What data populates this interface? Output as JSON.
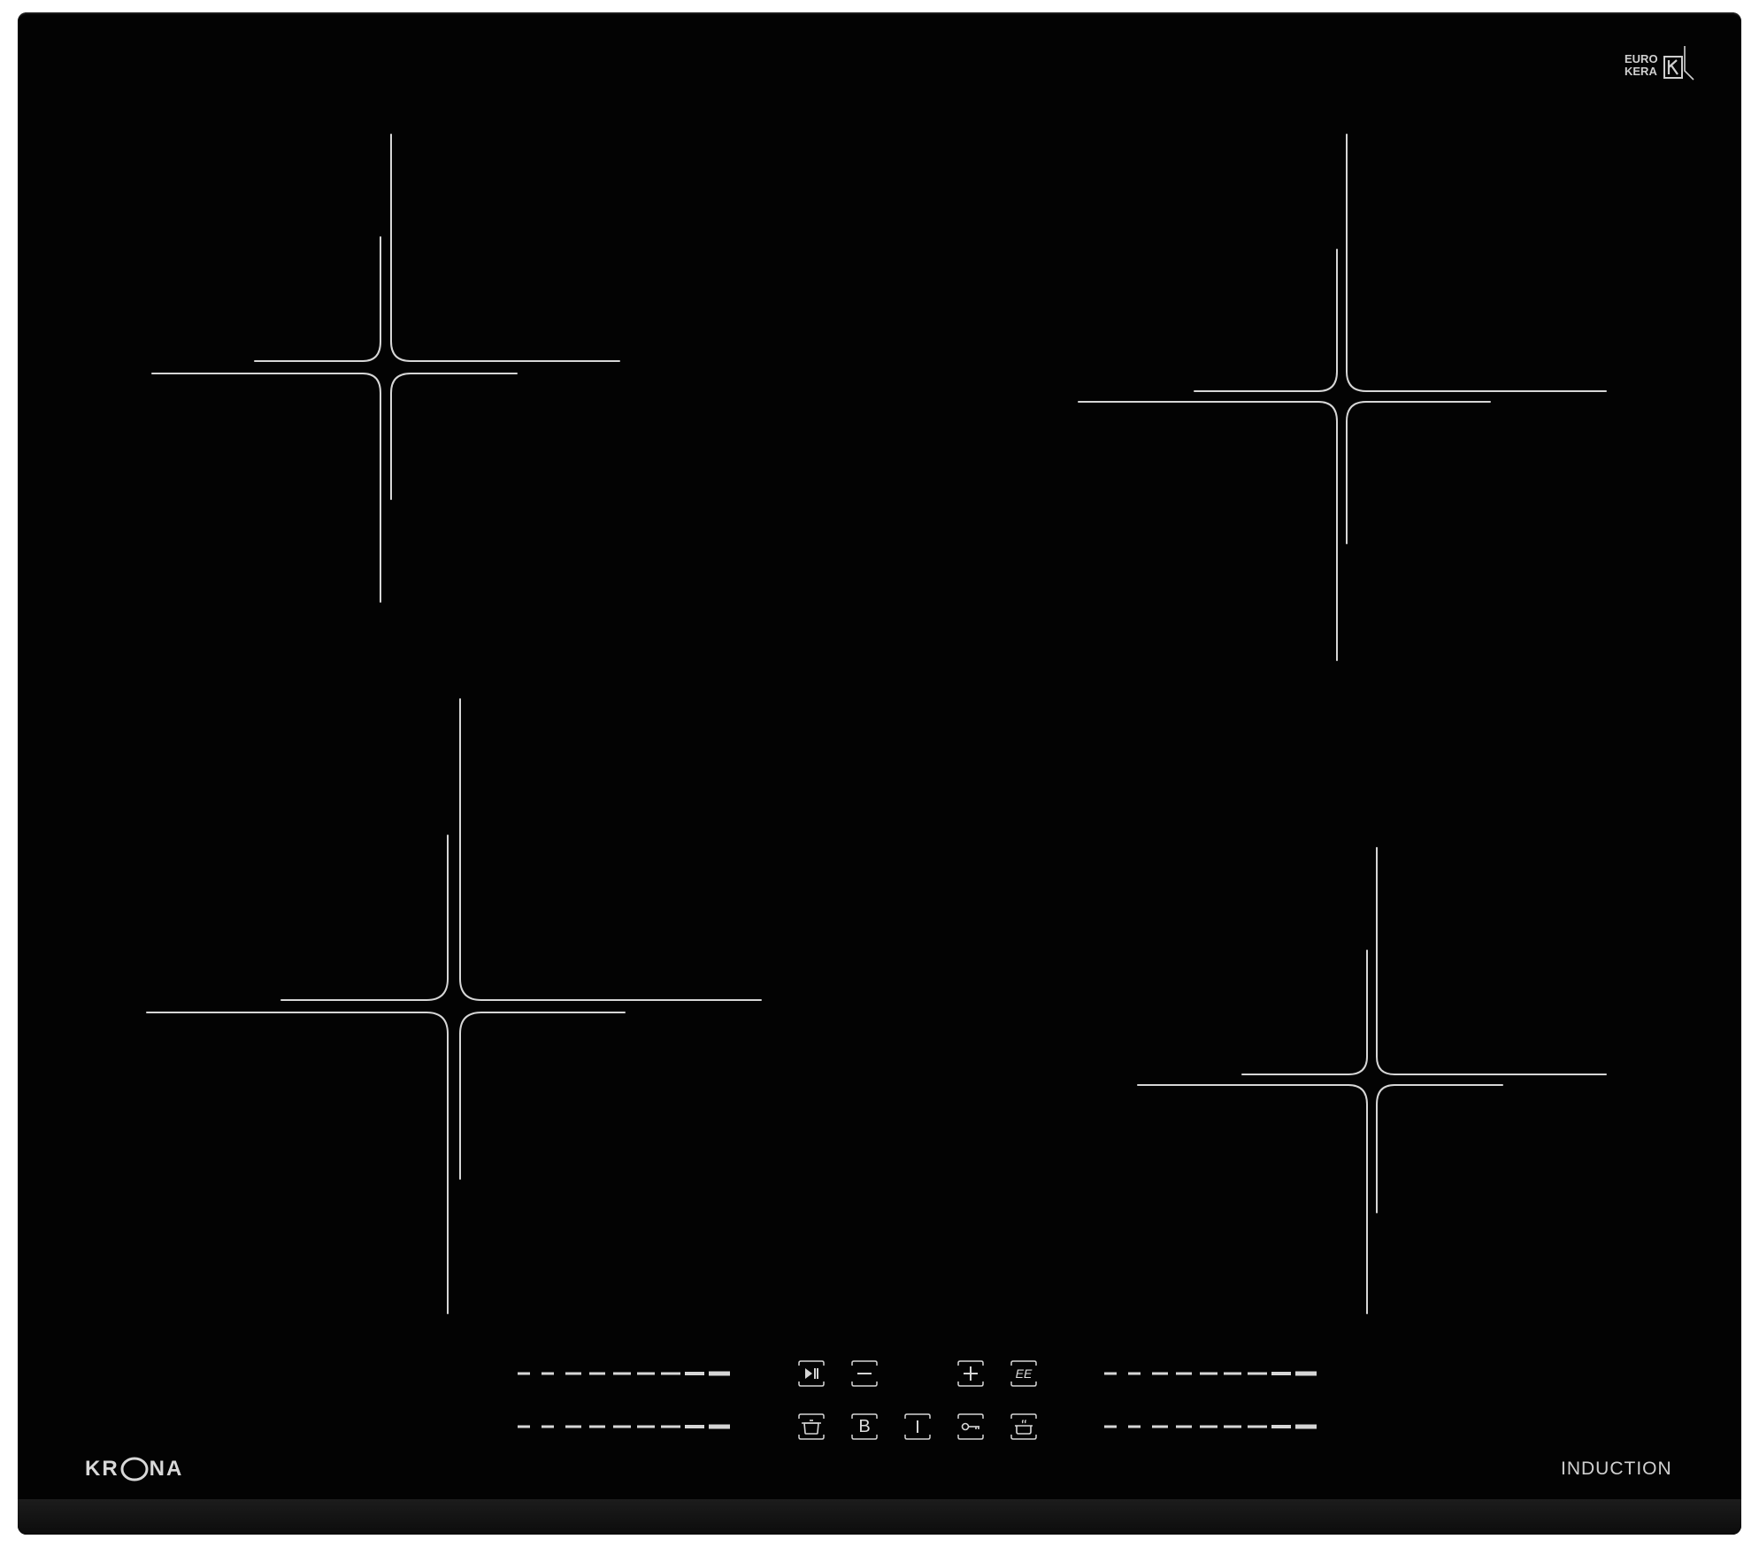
{
  "brand": {
    "name_prefix": "KR",
    "name_suffix": "NA"
  },
  "cooktop": {
    "type_label": "INDUCTION",
    "certification_logo_line1": "EURO",
    "certification_logo_line2": "KERA"
  },
  "controls": {
    "top_row": [
      {
        "name": "play-pause",
        "icon": "play-pause-icon"
      },
      {
        "name": "minus",
        "icon": "minus-icon"
      },
      {
        "name": "plus",
        "icon": "plus-icon"
      },
      {
        "name": "ee",
        "label": "EE"
      }
    ],
    "bottom_row": [
      {
        "name": "pot",
        "icon": "pot-icon"
      },
      {
        "name": "b",
        "label": "B"
      },
      {
        "name": "power",
        "icon": "power-icon"
      },
      {
        "name": "key-lock",
        "icon": "key-icon"
      },
      {
        "name": "keep-warm",
        "icon": "keep-warm-icon"
      }
    ]
  },
  "colors": {
    "glass": "#030303",
    "marking": "#d6d6d6"
  }
}
